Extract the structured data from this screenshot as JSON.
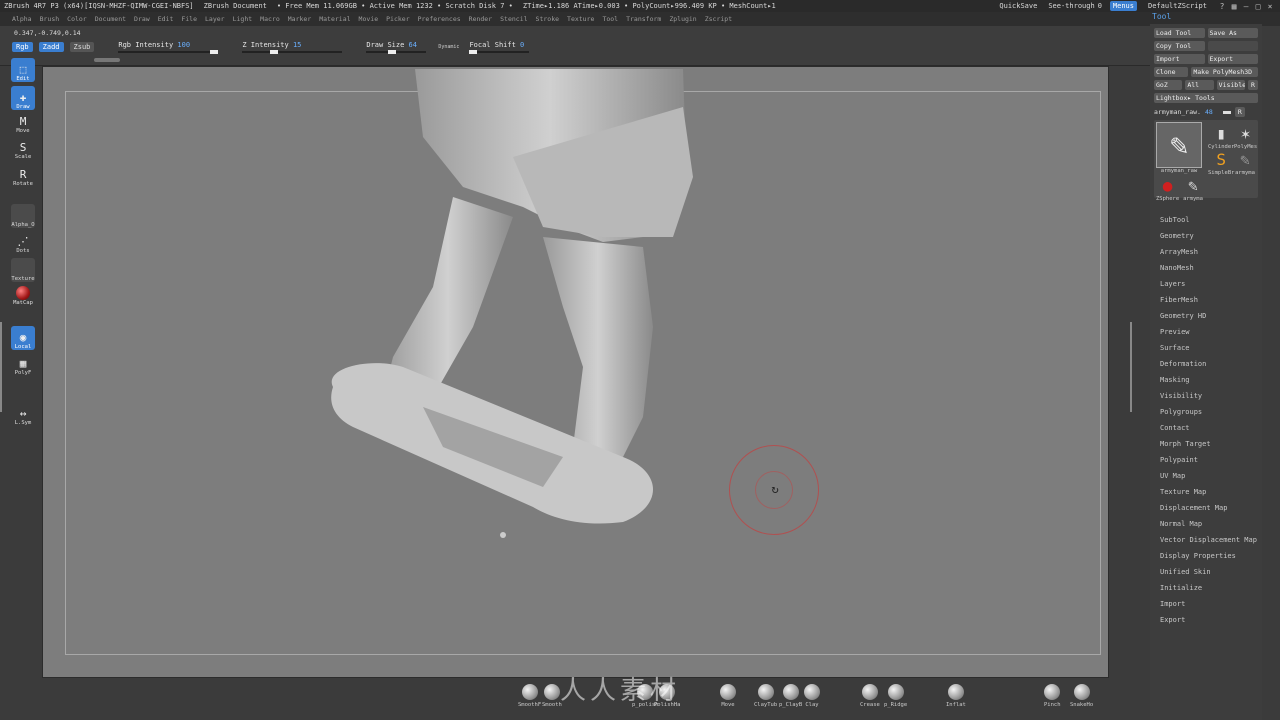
{
  "titlebar": {
    "app": "ZBrush 4R7 P3 (x64)[IQSN-MHZF-QIMW-CGEI-NBFS]",
    "doc": "ZBrush Document",
    "mem": "• Free Mem 11.069GB • Active Mem 1232 • Scratch Disk 7 •",
    "ztime": "ZTime▸1.186 ATime▸0.003 • PolyCount▸996.409 KP • MeshCount▸1",
    "quicksave": "QuickSave",
    "seethrough": "See-through",
    "seethrough_value": "0",
    "menus": "Menus",
    "script": "DefaultZScript"
  },
  "menubar": [
    "Alpha",
    "Brush",
    "Color",
    "Document",
    "Draw",
    "Edit",
    "File",
    "Layer",
    "Light",
    "Macro",
    "Marker",
    "Material",
    "Movie",
    "Picker",
    "Preferences",
    "Render",
    "Stencil",
    "Stroke",
    "Texture",
    "Tool",
    "Transform",
    "Zplugin",
    "Zscript"
  ],
  "toolbar": {
    "coords": "0.347,-0.749,0.14",
    "rgb": "Rgb",
    "zadd": "Zadd",
    "zsub": "Zsub",
    "rgb_intensity_label": "Rgb Intensity",
    "rgb_intensity_value": "100",
    "z_intensity_label": "Z Intensity",
    "z_intensity_value": "15",
    "draw_size_label": "Draw Size",
    "draw_size_value": "64",
    "dynamic": "Dynamic",
    "focal_shift_label": "Focal Shift",
    "focal_shift_value": "0"
  },
  "leftshelf": {
    "edit": "Edit",
    "draw": "Draw",
    "move": "Move",
    "scale": "Scale",
    "rotate": "Rotate",
    "alpha": "Alpha_O",
    "dots": "Dots",
    "texture": "Texture",
    "matcap": "MatCap",
    "local": "Local",
    "polyf": "PolyF",
    "lsym": "L.Sym"
  },
  "rightpanel": {
    "header": "Tool",
    "load_tool": "Load Tool",
    "save_as": "Save As",
    "copy_tool": "Copy Tool",
    "paste_tool": "",
    "import": "Import",
    "export": "Export",
    "clone": "Clone",
    "make_polymesh": "Make PolyMesh3D",
    "goz": "GoZ",
    "all": "All",
    "visible": "Visible",
    "r": "R",
    "lightbox": "Lightbox▸ Tools",
    "tool_name": "armyman_raw.",
    "tool_count": "48",
    "thumbs": {
      "main": "armyman_raw",
      "cylinder": "Cylinder",
      "polymesh": "PolyMes",
      "simplebrush": "SimpleBr",
      "armyman2": "armyma",
      "zsphere": "ZSphere",
      "armyman3": "armyma"
    },
    "menus": [
      "SubTool",
      "Geometry",
      "ArrayMesh",
      "NanoMesh",
      "Layers",
      "FiberMesh",
      "Geometry HD",
      "Preview",
      "Surface",
      "Deformation",
      "Masking",
      "Visibility",
      "Polygroups",
      "Contact",
      "Morph Target",
      "Polypaint",
      "UV Map",
      "Texture Map",
      "Displacement Map",
      "Normal Map",
      "Vector Displacement Map",
      "Display Properties",
      "Unified Skin",
      "Initialize",
      "Import",
      "Export"
    ]
  },
  "bottomshelf": [
    "SmoothF",
    "Smooth",
    "p_polish",
    "PolishHa",
    "Move",
    "ClayTub",
    "p_ClayB",
    "Clay",
    "Crease",
    "p_Ridge",
    "Inflat",
    "Pinch",
    "SnakeHo"
  ],
  "watermark": "人人素材"
}
